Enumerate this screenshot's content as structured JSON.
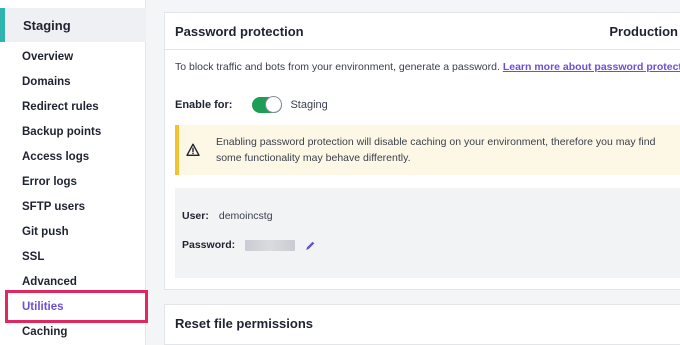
{
  "sidebar": {
    "environment": "Staging",
    "items": [
      {
        "label": "Overview"
      },
      {
        "label": "Domains"
      },
      {
        "label": "Redirect rules"
      },
      {
        "label": "Backup points"
      },
      {
        "label": "Access logs"
      },
      {
        "label": "Error logs"
      },
      {
        "label": "SFTP users"
      },
      {
        "label": "Git push"
      },
      {
        "label": "SSL"
      },
      {
        "label": "Advanced"
      },
      {
        "label": "Utilities",
        "active": true
      },
      {
        "label": "Caching"
      }
    ]
  },
  "password_protection": {
    "title": "Password protection",
    "environment_tag": "Production",
    "description": "To block traffic and bots from your environment, generate a password. ",
    "learn_more": "Learn more about password protect",
    "enable_label": "Enable for:",
    "toggle_text": "Staging",
    "toggle_on": true,
    "notice": "Enabling password protection will disable caching on your environment, therefore you may find some functionality may behave differently.",
    "user_label": "User:",
    "user_value": "demoincstg",
    "password_label": "Password:"
  },
  "reset_permissions": {
    "title": "Reset file permissions"
  },
  "colors": {
    "accent": "#6e4fd1",
    "toggle_on": "#1f9d55",
    "highlight": "#e0275f",
    "env_bar": "#2fb5b0",
    "notice_bar": "#f2c230"
  }
}
